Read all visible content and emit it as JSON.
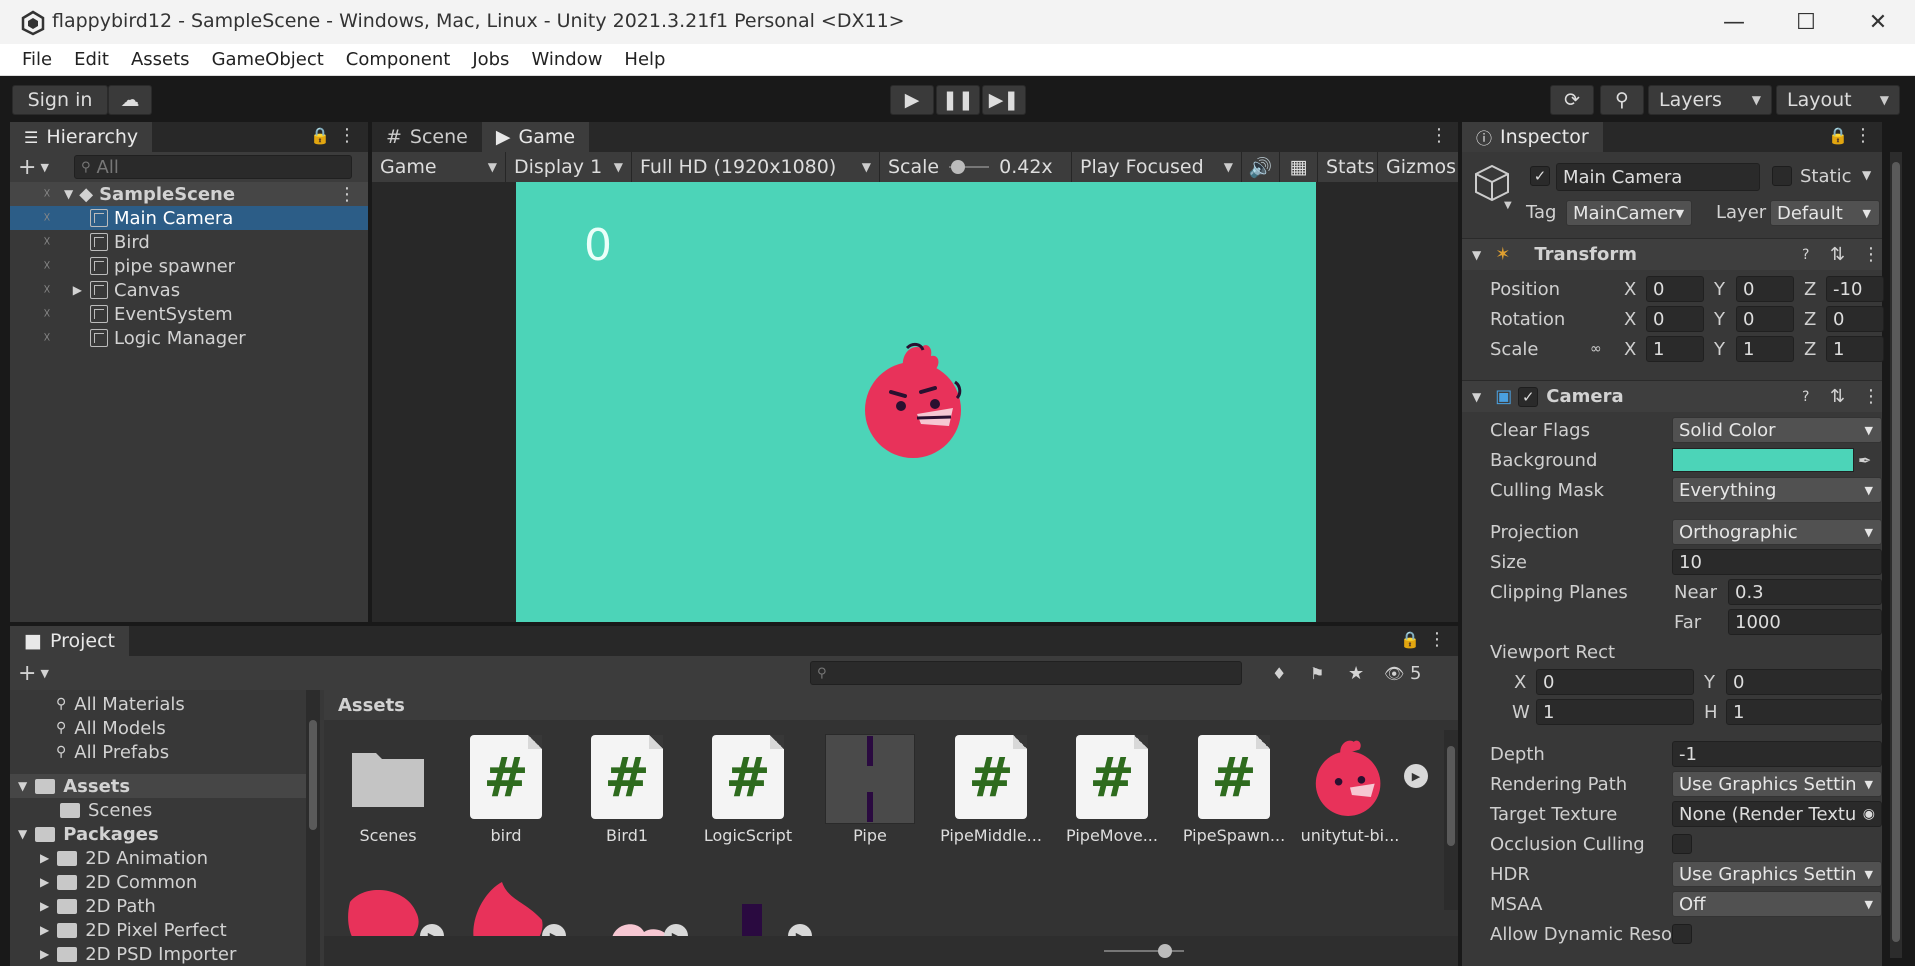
{
  "window": {
    "title": "flappybird12 - SampleScene - Windows, Mac, Linux - Unity 2021.3.21f1 Personal <DX11>"
  },
  "menu": [
    "File",
    "Edit",
    "Assets",
    "GameObject",
    "Component",
    "Jobs",
    "Window",
    "Help"
  ],
  "toolbar": {
    "sign_in": "Sign in",
    "layers": "Layers",
    "layout": "Layout"
  },
  "hierarchy": {
    "tab": "Hierarchy",
    "search_placeholder": "All",
    "scene": "SampleScene",
    "items": [
      "Main Camera",
      "Bird",
      "pipe spawner",
      "Canvas",
      "EventSystem",
      "Logic Manager"
    ]
  },
  "game": {
    "tabs": [
      "Scene",
      "Game"
    ],
    "view_mode": "Game",
    "display": "Display 1",
    "resolution": "Full HD (1920x1080)",
    "scale_label": "Scale",
    "scale_value": "0.42x",
    "play_mode": "Play Focused",
    "stats": "Stats",
    "gizmos": "Gizmos",
    "score": "0",
    "bg_color": "#4cd4b8"
  },
  "inspector": {
    "tab": "Inspector",
    "object_name": "Main Camera",
    "static_label": "Static",
    "tag_label": "Tag",
    "tag_value": "MainCamer",
    "layer_label": "Layer",
    "layer_value": "Default",
    "transform": {
      "title": "Transform",
      "position_label": "Position",
      "position": [
        "0",
        "0",
        "-10"
      ],
      "rotation_label": "Rotation",
      "rotation": [
        "0",
        "0",
        "0"
      ],
      "scale_label": "Scale",
      "scale": [
        "1",
        "1",
        "1"
      ]
    },
    "camera": {
      "title": "Camera",
      "clear_flags_label": "Clear Flags",
      "clear_flags": "Solid Color",
      "background_label": "Background",
      "background_color": "#4cd4b8",
      "culling_mask_label": "Culling Mask",
      "culling_mask": "Everything",
      "projection_label": "Projection",
      "projection": "Orthographic",
      "size_label": "Size",
      "size": "10",
      "clipping_label": "Clipping Planes",
      "near_label": "Near",
      "near": "0.3",
      "far_label": "Far",
      "far": "1000",
      "viewport_label": "Viewport Rect",
      "vx": "0",
      "vy": "0",
      "vw": "1",
      "vh": "1",
      "depth_label": "Depth",
      "depth": "-1",
      "rendering_path_label": "Rendering Path",
      "rendering_path": "Use Graphics Setting",
      "target_texture_label": "Target Texture",
      "target_texture": "None (Render Textu",
      "occlusion_label": "Occlusion Culling",
      "hdr_label": "HDR",
      "hdr": "Use Graphics Setting",
      "msaa_label": "MSAA",
      "msaa": "Off",
      "dynamic_res_label": "Allow Dynamic Reso"
    }
  },
  "project": {
    "tab": "Project",
    "hidden_count": "5",
    "favorites": [
      "All Materials",
      "All Models",
      "All Prefabs"
    ],
    "assets_label": "Assets",
    "scenes_label": "Scenes",
    "packages_label": "Packages",
    "packages": [
      "2D Animation",
      "2D Common",
      "2D Path",
      "2D Pixel Perfect",
      "2D PSD Importer"
    ],
    "breadcrumb": "Assets",
    "assets": [
      "Scenes",
      "bird",
      "Bird1",
      "LogicScript",
      "Pipe",
      "PipeMiddle...",
      "PipeMove...",
      "PipeSpawn...",
      "unitytut-bi..."
    ]
  }
}
